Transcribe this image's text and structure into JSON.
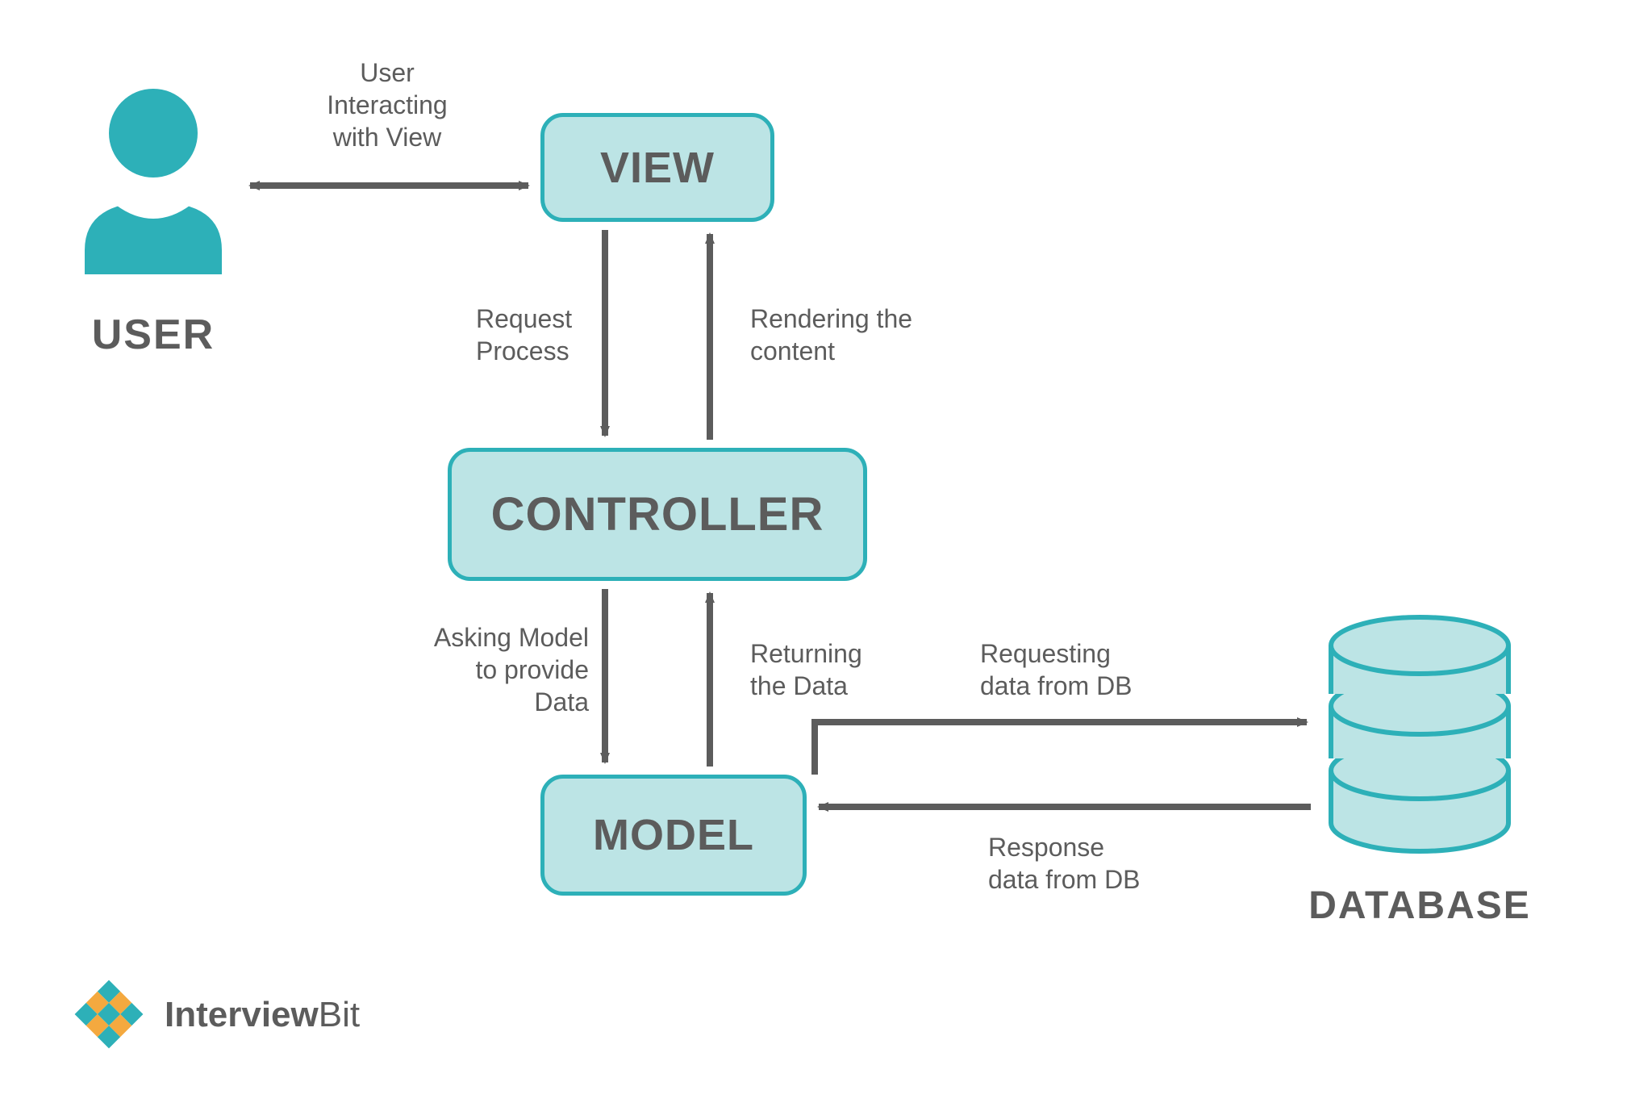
{
  "nodes": {
    "user": "USER",
    "view": "VIEW",
    "controller": "CONTROLLER",
    "model": "MODEL",
    "database": "DATABASE"
  },
  "edges": {
    "user_view": "User\nInteracting\nwith View",
    "view_to_controller": "Request\nProcess",
    "controller_to_view": "Rendering the\ncontent",
    "controller_to_model": "Asking Model\nto provide\nData",
    "model_to_controller": "Returning\nthe Data",
    "model_to_db": "Requesting\ndata from DB",
    "db_to_model": "Response\ndata from DB"
  },
  "branding": {
    "name_a": "Interview",
    "name_b": "Bit"
  },
  "colors": {
    "box_fill": "#bce4e5",
    "box_border": "#2db0b8",
    "arrow": "#5c5c5c",
    "text": "#5c5c5c",
    "accent_orange": "#f4a93f",
    "accent_teal": "#2db0b8"
  }
}
